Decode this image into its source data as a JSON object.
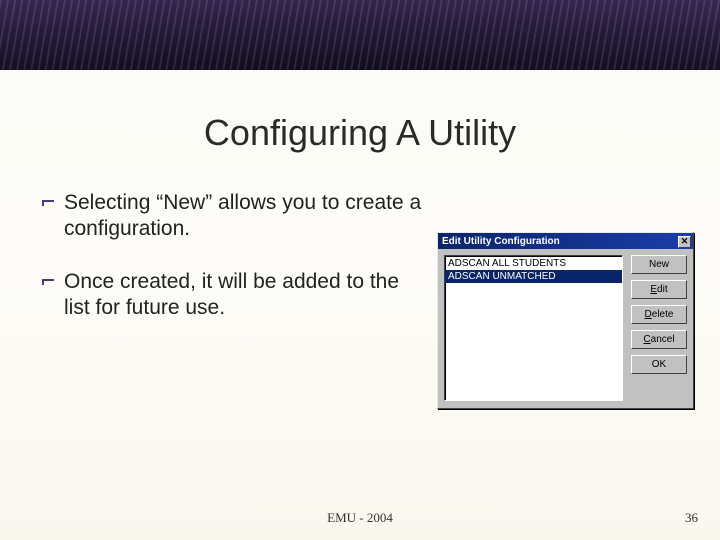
{
  "slide": {
    "title": "Configuring A Utility",
    "bullets": [
      "Selecting “New” allows you to create a configuration.",
      "Once created, it will be added to the list for future use."
    ],
    "footer_center": "EMU - 2004",
    "footer_page": "36"
  },
  "dialog": {
    "title": "Edit Utility Configuration",
    "list": {
      "items": [
        "ADSCAN ALL STUDENTS",
        "ADSCAN UNMATCHED"
      ],
      "selected_index": 1
    },
    "buttons": {
      "new": "New",
      "edit_prefix": "E",
      "edit_rest": "dit",
      "delete_prefix": "D",
      "delete_rest": "elete",
      "cancel_prefix": "C",
      "cancel_rest": "ancel",
      "ok": "OK"
    },
    "close_glyph": "✕"
  }
}
